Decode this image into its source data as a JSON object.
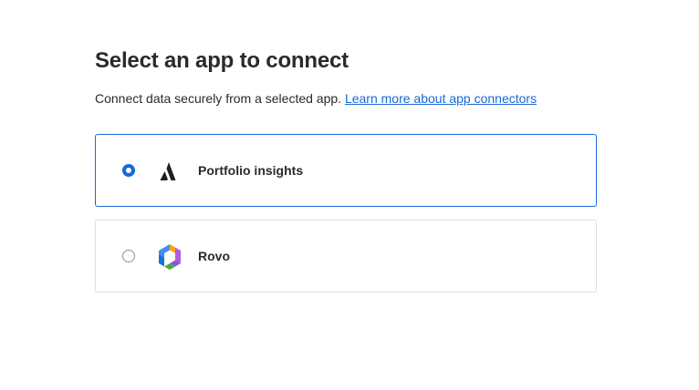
{
  "header": {
    "title": "Select an app to connect",
    "description": "Connect data securely from a selected app.",
    "learn_more_link": "Learn more about app connectors"
  },
  "options": [
    {
      "label": "Portfolio insights",
      "icon": "atlassian-logo-icon",
      "selected": true
    },
    {
      "label": "Rovo",
      "icon": "rovo-logo-icon",
      "selected": false
    }
  ],
  "colors": {
    "accent": "#1868db",
    "text": "#292a2e",
    "border": "#dcdfe4"
  }
}
